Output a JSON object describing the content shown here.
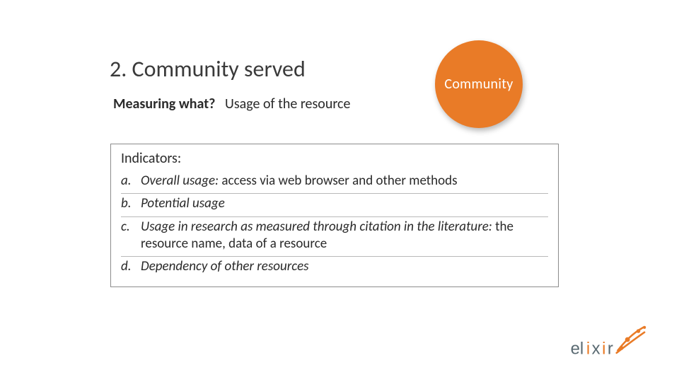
{
  "title": "2. Community served",
  "badge": {
    "label": "Community",
    "color": "#e97b27"
  },
  "subtitle": {
    "label": "Measuring what?",
    "value": "Usage of the resource"
  },
  "indicators": {
    "heading": "Indicators:",
    "items": [
      {
        "marker": "a.",
        "lead": "Overall usage:",
        "trail": " access via web browser and other methods"
      },
      {
        "marker": "b.",
        "lead": "Potential usage",
        "trail": ""
      },
      {
        "marker": "c.",
        "lead": "Usage in research as measured through citation in the literature:",
        "trail": " the resource name, data of a resource"
      },
      {
        "marker": "d.",
        "lead": "Dependency of other resources",
        "trail": ""
      }
    ]
  },
  "logo": {
    "name": "elixir"
  }
}
